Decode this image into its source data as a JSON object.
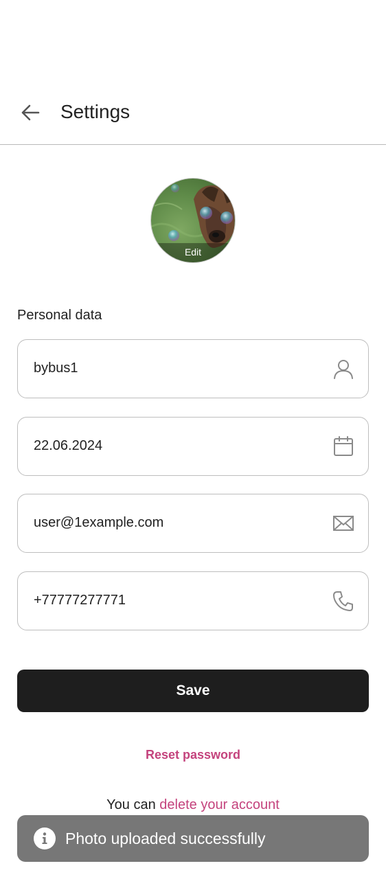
{
  "header": {
    "title": "Settings",
    "back_icon": "arrow-left-icon"
  },
  "avatar": {
    "edit_label": "Edit"
  },
  "personal": {
    "section_label": "Personal data",
    "username": {
      "value": "bybus1",
      "icon": "user-icon"
    },
    "birthdate": {
      "value": "22.06.2024",
      "icon": "calendar-icon"
    },
    "email": {
      "value": "user@1example.com",
      "icon": "envelope-icon"
    },
    "phone": {
      "value": "+77777277771",
      "icon": "phone-icon"
    }
  },
  "actions": {
    "save_label": "Save",
    "reset_password_label": "Reset password",
    "delete_prefix": "You can ",
    "delete_link": "delete your account"
  },
  "toast": {
    "icon": "info-icon",
    "message": "Photo uploaded successfully"
  },
  "colors": {
    "accent": "#c4437d",
    "button_bg": "#1e1e1e",
    "toast_bg": "#777777",
    "border": "#bdbdbd"
  }
}
